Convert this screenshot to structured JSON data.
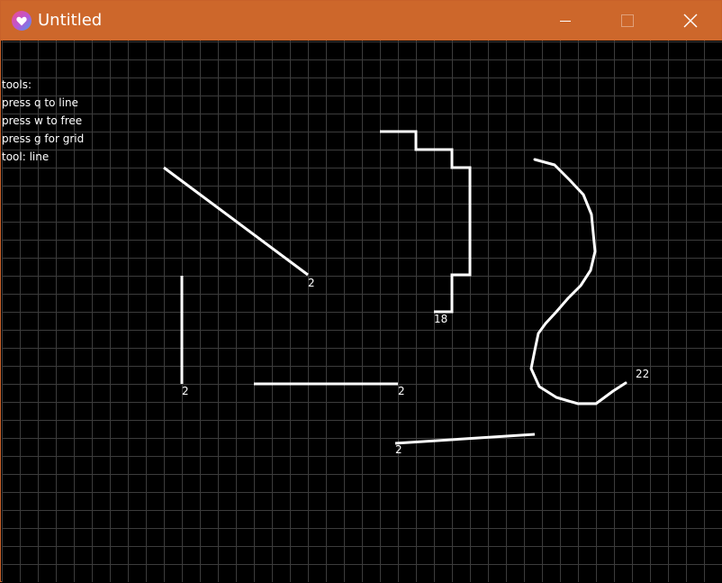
{
  "window": {
    "title": "Untitled",
    "titlebar_color": "#cd672b",
    "controls": [
      "minimize-icon",
      "maximize-icon",
      "close-icon"
    ]
  },
  "canvas": {
    "background": "#000000",
    "grid_color": "#3c3c3c",
    "stroke_color": "#ffffff"
  },
  "help": {
    "lines": [
      "tools:",
      "press q to line",
      "press w to free",
      "press g for grid",
      "tool: line"
    ]
  },
  "strokes": {
    "diagonal_line_label": "2",
    "staircase_path_label": "18",
    "vertical_line_label": "2",
    "horizontal_line_label": "2",
    "freehand_curve_label": "22",
    "bottom_line_label": "2"
  }
}
